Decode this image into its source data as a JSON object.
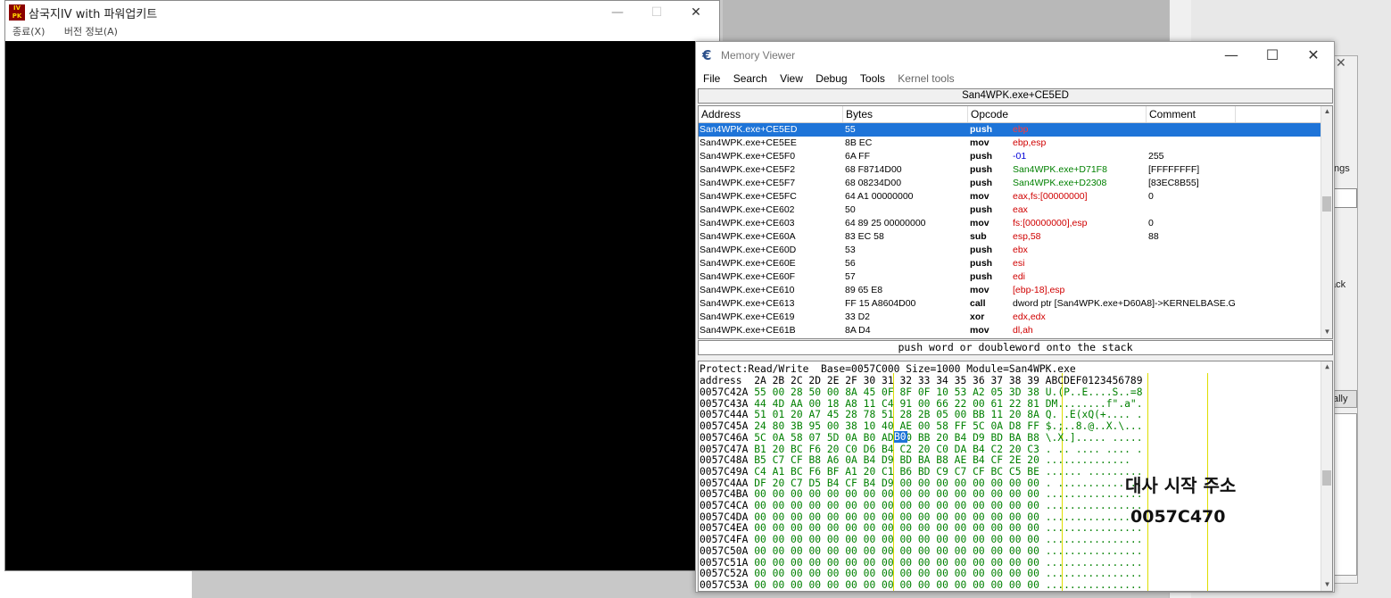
{
  "game_window": {
    "title": "삼국지IV with 파워업키트",
    "icon_text": "IV PK",
    "menu": [
      "종료(X)",
      "버전 정보(A)"
    ],
    "caption_buttons": [
      "—",
      "☐",
      "✕"
    ]
  },
  "memory_viewer": {
    "title": "Memory Viewer",
    "caption_buttons": [
      "—",
      "☐",
      "✕"
    ],
    "menu": [
      "File",
      "Search",
      "View",
      "Debug",
      "Tools",
      "Kernel tools"
    ],
    "address_bar": "San4WPK.exe+CE5ED",
    "disasm": {
      "columns": [
        "Address",
        "Bytes",
        "Opcode",
        "Comment"
      ],
      "rows": [
        {
          "address": "San4WPK.exe+CE5ED",
          "bytes": "55",
          "opcode": "push",
          "args": "ebp",
          "comment": ""
        },
        {
          "address": "San4WPK.exe+CE5EE",
          "bytes": "8B EC",
          "opcode": "mov",
          "args": "ebp,esp",
          "comment": ""
        },
        {
          "address": "San4WPK.exe+CE5F0",
          "bytes": "6A FF",
          "opcode": "push",
          "args": "-01",
          "comment": "255"
        },
        {
          "address": "San4WPK.exe+CE5F2",
          "bytes": "68 F8714D00",
          "opcode": "push",
          "args": "San4WPK.exe+D71F8",
          "comment": "[FFFFFFFF]"
        },
        {
          "address": "San4WPK.exe+CE5F7",
          "bytes": "68 08234D00",
          "opcode": "push",
          "args": "San4WPK.exe+D2308",
          "comment": "[83EC8B55]"
        },
        {
          "address": "San4WPK.exe+CE5FC",
          "bytes": "64 A1 00000000",
          "opcode": "mov",
          "args": "eax,fs:[00000000]",
          "comment": "0"
        },
        {
          "address": "San4WPK.exe+CE602",
          "bytes": "50",
          "opcode": "push",
          "args": "eax",
          "comment": ""
        },
        {
          "address": "San4WPK.exe+CE603",
          "bytes": "64 89 25 00000000",
          "opcode": "mov",
          "args": "fs:[00000000],esp",
          "comment": "0"
        },
        {
          "address": "San4WPK.exe+CE60A",
          "bytes": "83 EC 58",
          "opcode": "sub",
          "args": "esp,58",
          "comment": "88"
        },
        {
          "address": "San4WPK.exe+CE60D",
          "bytes": "53",
          "opcode": "push",
          "args": "ebx",
          "comment": ""
        },
        {
          "address": "San4WPK.exe+CE60E",
          "bytes": "56",
          "opcode": "push",
          "args": "esi",
          "comment": ""
        },
        {
          "address": "San4WPK.exe+CE60F",
          "bytes": "57",
          "opcode": "push",
          "args": "edi",
          "comment": ""
        },
        {
          "address": "San4WPK.exe+CE610",
          "bytes": "89 65 E8",
          "opcode": "mov",
          "args": "[ebp-18],esp",
          "comment": ""
        },
        {
          "address": "San4WPK.exe+CE613",
          "bytes": "FF 15 A8604D00",
          "opcode": "call",
          "args": "dword ptr [San4WPK.exe+D60A8]->KERNELBASE.G",
          "comment": ""
        },
        {
          "address": "San4WPK.exe+CE619",
          "bytes": "33 D2",
          "opcode": "xor",
          "args": "edx,edx",
          "comment": ""
        },
        {
          "address": "San4WPK.exe+CE61B",
          "bytes": "8A D4",
          "opcode": "mov",
          "args": "dl,ah",
          "comment": ""
        }
      ]
    },
    "instruction_desc": "push word or doubleword onto the stack",
    "hex": {
      "info": "Protect:Read/Write  Base=0057C000 Size=1000 Module=San4WPK.exe",
      "header": "address  2A 2B 2C 2D 2E 2F 30 31 32 33 34 35 36 37 38 39 ABCDEF0123456789",
      "rows": [
        {
          "addr": "0057C42A",
          "bytes": "55 00 28 50 00 8A 45 0F 8F 0F 10 53 A2 05 3D 38",
          "ascii": "U.(P..E....S..=8"
        },
        {
          "addr": "0057C43A",
          "bytes": "44 4D AA 00 18 A8 11 C4 91 00 66 22 00 61 22 81",
          "ascii": "DM........f\".a\"."
        },
        {
          "addr": "0057C44A",
          "bytes": "51 01 20 A7 45 28 78 51 28 2B 05 00 BB 11 20 8A",
          "ascii": "Q. .E(xQ(+.... ."
        },
        {
          "addr": "0057C45A",
          "bytes": "24 80 3B 95 00 38 10 40 AE 00 58 FF 5C 0A D8 FF",
          "ascii": "$.;..8.@..X.\\..."
        },
        {
          "addr": "0057C46A",
          "bytes": "5C 0A 58 07 5D 0A B0 AD C0 BB 20 B4 D9 BD BA B8",
          "ascii": "\\.X.]..... ....."
        },
        {
          "addr": "0057C47A",
          "bytes": "B1 20 BC F6 20 C0 D6 B4 C2 20 C0 DA B4 C2 20 C3",
          "ascii": ". .. .... .... ."
        },
        {
          "addr": "0057C48A",
          "bytes": "B5 C7 CF B8 A6 0A B4 D9 BD BA B8 AE B4 CF 2E 20",
          "ascii": "..............  "
        },
        {
          "addr": "0057C49A",
          "bytes": "C4 A1 BC F6 BF A1 20 C1 B6 BD C9 C7 CF BC C5 BE",
          "ascii": "...... ........."
        },
        {
          "addr": "0057C4AA",
          "bytes": "DF 20 C7 D5 B4 CF B4 D9 00 00 00 00 00 00 00 00",
          "ascii": ". .............."
        },
        {
          "addr": "0057C4BA",
          "bytes": "00 00 00 00 00 00 00 00 00 00 00 00 00 00 00 00",
          "ascii": "................"
        },
        {
          "addr": "0057C4CA",
          "bytes": "00 00 00 00 00 00 00 00 00 00 00 00 00 00 00 00",
          "ascii": "................"
        },
        {
          "addr": "0057C4DA",
          "bytes": "00 00 00 00 00 00 00 00 00 00 00 00 00 00 00 00",
          "ascii": "................"
        },
        {
          "addr": "0057C4EA",
          "bytes": "00 00 00 00 00 00 00 00 00 00 00 00 00 00 00 00",
          "ascii": "................"
        },
        {
          "addr": "0057C4FA",
          "bytes": "00 00 00 00 00 00 00 00 00 00 00 00 00 00 00 00",
          "ascii": "................"
        },
        {
          "addr": "0057C50A",
          "bytes": "00 00 00 00 00 00 00 00 00 00 00 00 00 00 00 00",
          "ascii": "................"
        },
        {
          "addr": "0057C51A",
          "bytes": "00 00 00 00 00 00 00 00 00 00 00 00 00 00 00 00",
          "ascii": "................"
        },
        {
          "addr": "0057C52A",
          "bytes": "00 00 00 00 00 00 00 00 00 00 00 00 00 00 00 00",
          "ascii": "................"
        },
        {
          "addr": "0057C53A",
          "bytes": "00 00 00 00 00 00 00 00 00 00 00 00 00 00 00 00",
          "ascii": "................"
        }
      ],
      "selected_byte": "B0",
      "annotation_title": "대사 시작 주소",
      "annotation_value": "0057C470"
    }
  },
  "background_window": {
    "fragments": [
      "ngs",
      "ack",
      "ally"
    ]
  },
  "colors": {
    "selection": "#1e74d8",
    "hex_text": "#008000",
    "register": "#d00000",
    "number": "#0000d8",
    "symbol": "#008000"
  }
}
